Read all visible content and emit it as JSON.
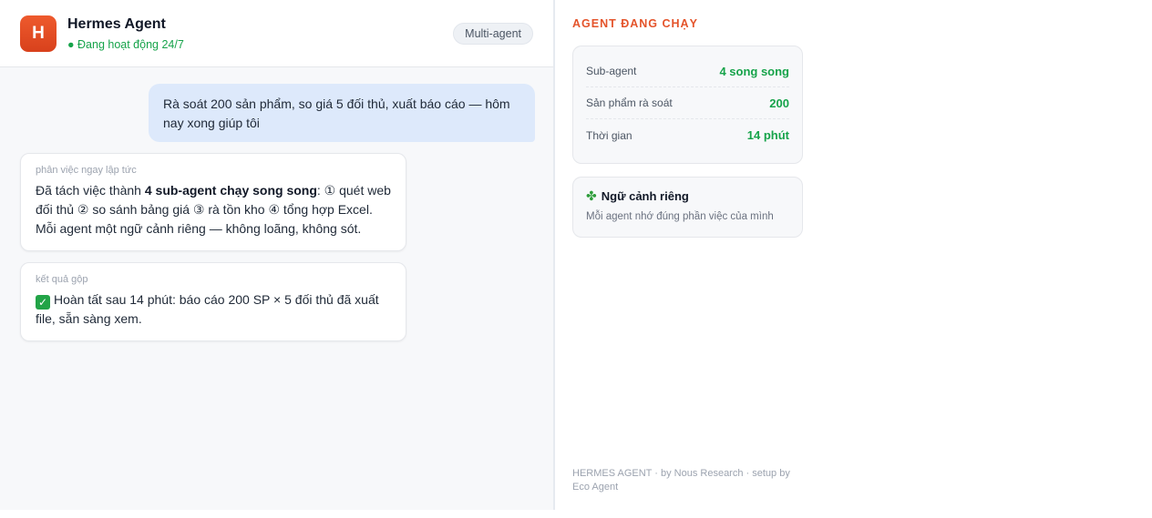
{
  "header": {
    "logo_letter": "H",
    "title": "Hermes Agent",
    "status": "● Đang hoạt động 24/7",
    "badge": "Multi-agent"
  },
  "chat": {
    "user_message": "Rà soát 200 sản phẩm, so giá 5 đối thủ, xuất báo cáo — hôm nay xong giúp tôi",
    "card1": {
      "tag": "phân việc ngay lập tức",
      "text_prefix": "Đã tách việc thành ",
      "text_bold": "4 sub-agent chạy song song",
      "text_suffix": ": ① quét web đối thủ ② so sánh bảng giá ③ rà tồn kho ④ tổng hợp Excel. Mỗi agent một ngữ cảnh riêng — không loãng, không sót."
    },
    "card2": {
      "tag": "kết quả gộp",
      "check_icon": "check-icon",
      "text": "Hoàn tất sau 14 phút: báo cáo 200 SP × 5 đối thủ đã xuất file, sẵn sàng xem."
    }
  },
  "sidebar": {
    "title": "AGENT ĐANG CHẠY",
    "stats": [
      {
        "label": "Sub-agent",
        "value": "4 song song"
      },
      {
        "label": "Sản phẩm rà soát",
        "value": "200"
      },
      {
        "label": "Thời gian",
        "value": "14 phút"
      }
    ],
    "context": {
      "icon": "clover-icon",
      "title": "Ngữ cảnh riêng",
      "description": "Mỗi agent nhớ đúng phần việc của mình"
    },
    "footer": "HERMES AGENT · by Nous Research · setup by Eco Agent"
  },
  "colors": {
    "accent": "#e4532a",
    "status_green": "#16a34a",
    "user_bubble": "#dde9fb"
  }
}
